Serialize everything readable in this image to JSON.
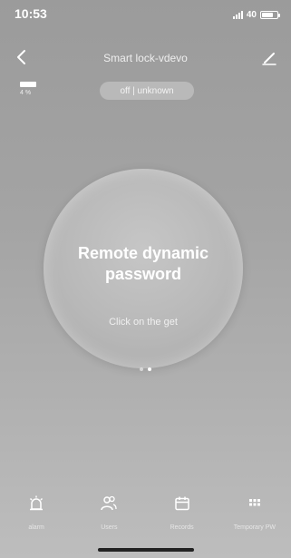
{
  "status_bar": {
    "time": "10:53",
    "network": "40"
  },
  "header": {
    "title": "Smart lock-vdevo"
  },
  "battery": {
    "percent_label": "4 %"
  },
  "lock_status": {
    "text": "off | unknown"
  },
  "main": {
    "circle_title": "Remote dynamic password",
    "circle_subtitle": "Click on the get"
  },
  "pager": {
    "count": 2,
    "active": 1
  },
  "bottom_nav": {
    "items": [
      {
        "label": "alarm",
        "icon": "alarm-icon"
      },
      {
        "label": "Users",
        "icon": "users-icon"
      },
      {
        "label": "Records",
        "icon": "calendar-icon"
      },
      {
        "label": "Temporary PW",
        "icon": "grid-icon"
      }
    ]
  }
}
